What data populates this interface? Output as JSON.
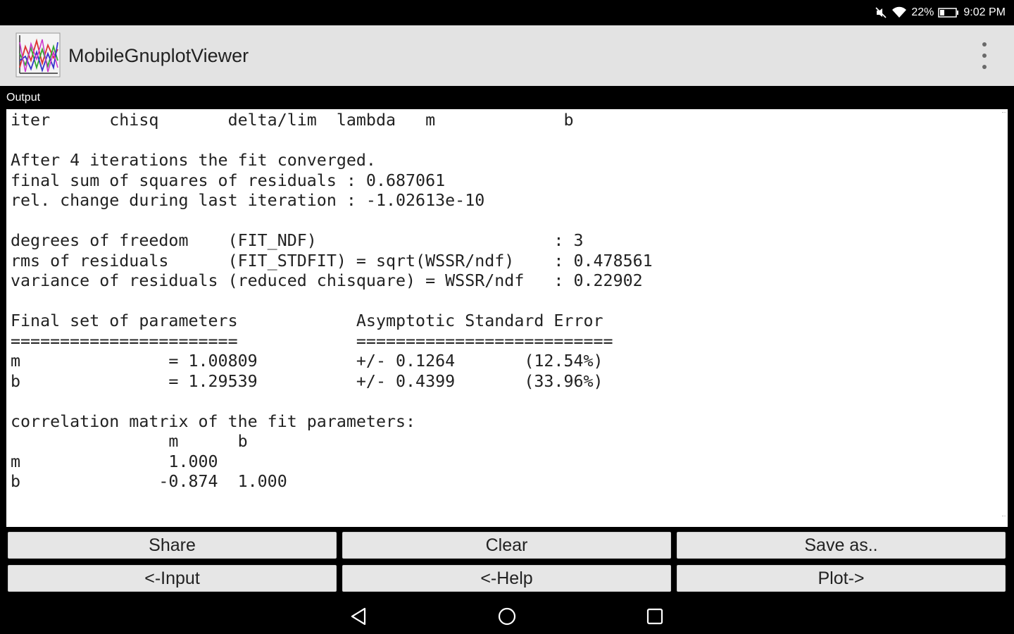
{
  "status_bar": {
    "battery_percent": "22%",
    "time": "9:02 PM",
    "icons": [
      "mute-icon",
      "wifi-icon",
      "battery-icon"
    ]
  },
  "app_bar": {
    "title": "MobileGnuplotViewer",
    "app_icon": "gnuplot-chart-icon",
    "menu_icon": "overflow-menu-icon"
  },
  "output": {
    "label": "Output",
    "text": "iter      chisq       delta/lim  lambda   m             b\n\nAfter 4 iterations the fit converged.\nfinal sum of squares of residuals : 0.687061\nrel. change during last iteration : -1.02613e-10\n\ndegrees of freedom    (FIT_NDF)                        : 3\nrms of residuals      (FIT_STDFIT) = sqrt(WSSR/ndf)    : 0.478561\nvariance of residuals (reduced chisquare) = WSSR/ndf   : 0.22902\n\nFinal set of parameters            Asymptotic Standard Error\n=======================            ==========================\nm               = 1.00809          +/- 0.1264       (12.54%)\nb               = 1.29539          +/- 0.4399       (33.96%)\n\ncorrelation matrix of the fit parameters:\n                m      b\nm               1.000\nb              -0.874  1.000"
  },
  "buttons": {
    "share": "Share",
    "clear": "Clear",
    "save_as": "Save as..",
    "input": "<-Input",
    "help": "<-Help",
    "plot": "Plot->"
  },
  "nav_bar": {
    "icons": [
      "back-icon",
      "home-icon",
      "recents-icon"
    ]
  },
  "colors": {
    "app_bar_bg": "#e3e3e3",
    "button_bg": "#e6e6e6",
    "background": "#000000"
  }
}
